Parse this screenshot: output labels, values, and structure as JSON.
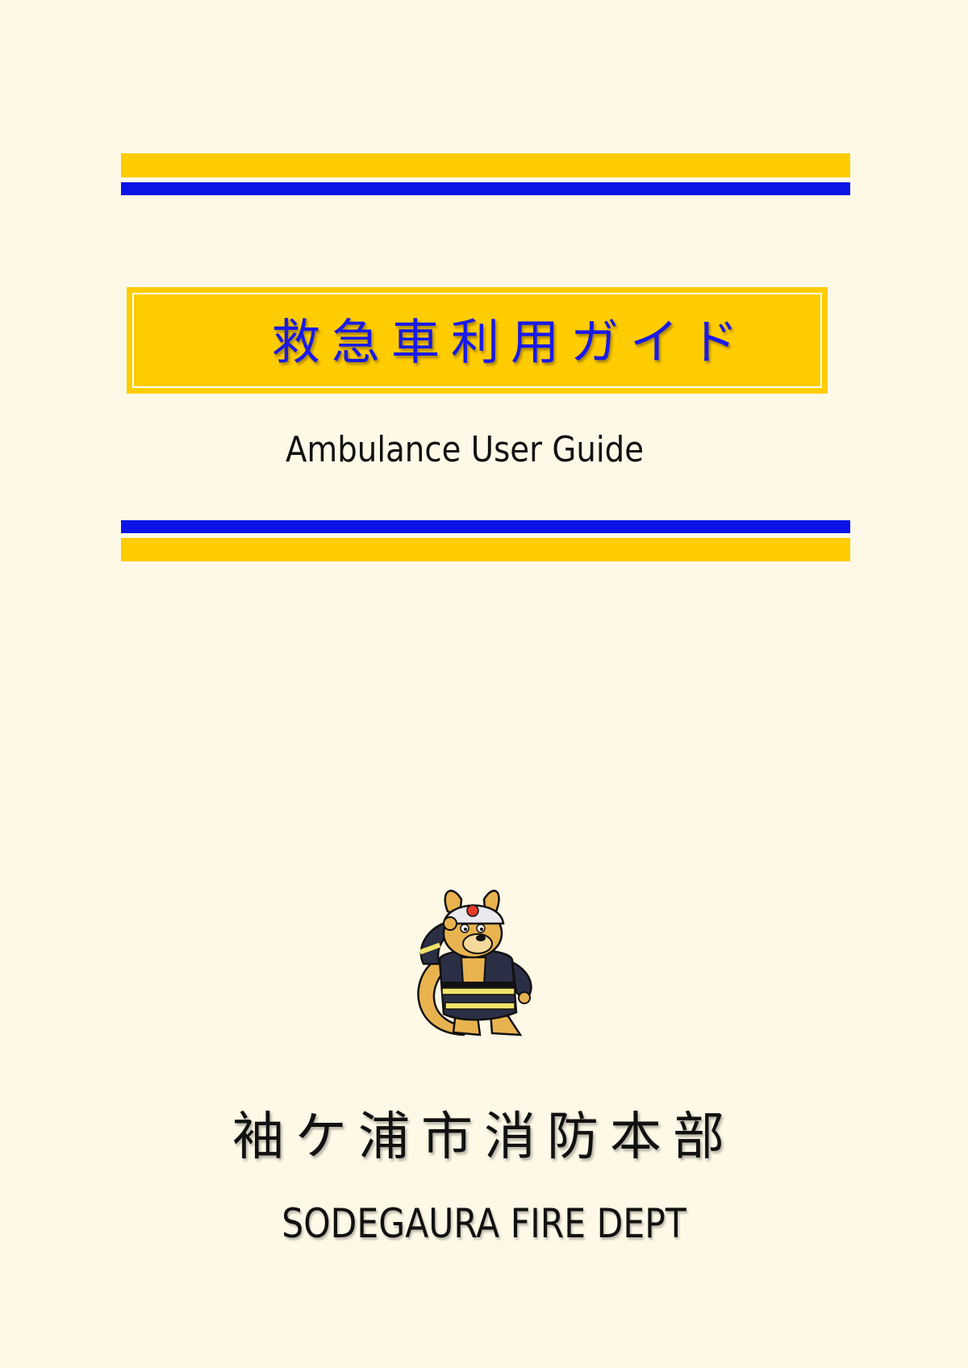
{
  "cover": {
    "title_jp": "救急車利用ガイド",
    "title_en": "Ambulance User Guide",
    "org_jp": "袖ケ浦市消防本部",
    "org_en": "SODEGAURA FIRE DEPT"
  },
  "mascot": {
    "icon": "kangaroo-firefighter-mascot"
  },
  "colors": {
    "background": "#fef9e7",
    "accent_yellow": "#ffcc00",
    "accent_blue": "#0a14e6",
    "title_text": "#1a1ae6"
  }
}
